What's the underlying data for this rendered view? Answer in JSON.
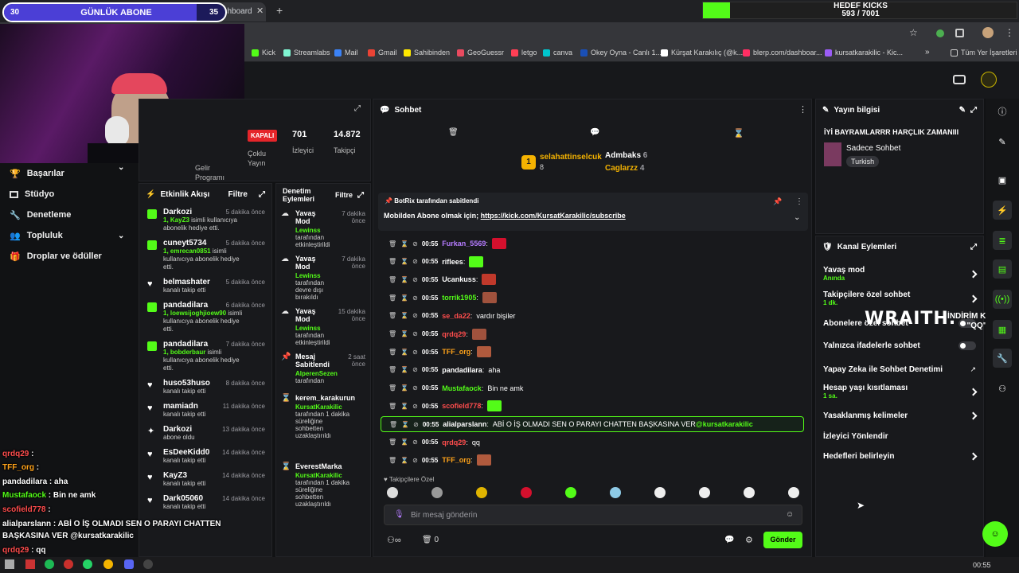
{
  "tabs": [
    {
      "label": "Kick Dashboard"
    }
  ],
  "sub_bar": {
    "left": "30",
    "label": "GÜNLÜK ABONE",
    "right": "35"
  },
  "kick_goal": {
    "title": "HEDEF KICKS",
    "count": "593 / 7001",
    "progress": 0.085
  },
  "bookmarks": [
    {
      "label": "Kick",
      "color": "#53fc18"
    },
    {
      "label": "Streamlabs",
      "color": "#80f5d2"
    },
    {
      "label": "Mail",
      "color": "#3b82f6"
    },
    {
      "label": "Gmail",
      "color": "#ea4335"
    },
    {
      "label": "Sahibinden",
      "color": "#ffe800"
    },
    {
      "label": "GeoGuessr",
      "color": "#e84a5f"
    },
    {
      "label": "letgo",
      "color": "#ff3f55"
    },
    {
      "label": "canva",
      "color": "#00c4cc"
    },
    {
      "label": "Okey Oyna - Canlı 1...",
      "color": "#1a4fb5"
    },
    {
      "label": "Kürşat Karakılıç (@k...",
      "color": "#ffffff"
    },
    {
      "label": "blerp.com/dashboar...",
      "color": "#ff2e63"
    },
    {
      "label": "kursatkarakilic - Kic...",
      "color": "#9b5cf6"
    }
  ],
  "bookmarks_other": "Tüm Yer İşaretleri",
  "sidebar": {
    "items": [
      {
        "label": "Başarılar",
        "icon": "trophy-icon"
      },
      {
        "label": "Stüdyo",
        "icon": "studio-icon"
      },
      {
        "label": "Denetleme",
        "icon": "wrench-icon"
      },
      {
        "label": "Topluluk",
        "icon": "users-icon"
      },
      {
        "label": "Droplar ve ödüller",
        "icon": "gift-icon"
      }
    ]
  },
  "stats": {
    "offline": "KAPALI",
    "multi": "Çoklu Yayın",
    "viewers": "701",
    "viewers_label": "İzleyici",
    "followers": "14.872",
    "followers_label": "Takipçi",
    "revenue": "Gelir Programı"
  },
  "activity": {
    "title": "Etkinlik Akışı",
    "filter": "Filtre",
    "items": [
      {
        "name": "Darkozi",
        "time": "5 dakika önce",
        "hl": "1, KayZ3",
        "desc": " isimli kullanıcıya abonelik hediye etti.",
        "kind": "gift"
      },
      {
        "name": "cuneyt5734",
        "time": "5 dakika önce",
        "hl": "1, emrecan0851",
        "desc": " isimli kullanıcıya abonelik hediye etti.",
        "kind": "gift"
      },
      {
        "name": "belmashater",
        "time": "5 dakika önce",
        "hl": "",
        "desc": "kanalı takip etti",
        "kind": "follow"
      },
      {
        "name": "pandadilara",
        "time": "6 dakika önce",
        "hl": "1, loewsijoghjioew90",
        "desc": " isimli kullanıcıya abonelik hediye etti.",
        "kind": "gift"
      },
      {
        "name": "pandadilara",
        "time": "7 dakika önce",
        "hl": "1, bobderbaur",
        "desc": " isimli kullanıcıya abonelik hediye etti.",
        "kind": "gift"
      },
      {
        "name": "huso53huso",
        "time": "8 dakika önce",
        "hl": "",
        "desc": "kanalı takip etti",
        "kind": "follow"
      },
      {
        "name": "mamiadn",
        "time": "11 dakika önce",
        "hl": "",
        "desc": "kanalı takip etti",
        "kind": "follow"
      },
      {
        "name": "Darkozi",
        "time": "13 dakika önce",
        "hl": "",
        "desc": "abone oldu",
        "kind": "sub"
      },
      {
        "name": "EsDeeKidd0",
        "time": "14 dakika önce",
        "hl": "",
        "desc": "kanalı takip etti",
        "kind": "follow"
      },
      {
        "name": "KayZ3",
        "time": "14 dakika önce",
        "hl": "",
        "desc": "kanalı takip etti",
        "kind": "follow"
      },
      {
        "name": "Dark05060",
        "time": "14 dakika önce",
        "hl": "",
        "desc": "kanalı takip etti",
        "kind": "follow"
      }
    ]
  },
  "modlog": {
    "title": "Denetim Eylemleri",
    "filter": "Filtre",
    "items": [
      {
        "name": "Yavaş Mod",
        "time": "7 dakika önce",
        "who": "Lewinss",
        "desc": " tarafından etkinleştirildi"
      },
      {
        "name": "Yavaş Mod",
        "time": "7 dakika önce",
        "who": "Lewinss",
        "desc": " tarafından devre dışı bırakıldı"
      },
      {
        "name": "Yavaş Mod",
        "time": "15 dakika önce",
        "who": "Lewinss",
        "desc": " tarafından etkinleştirildi"
      },
      {
        "name": "Mesaj Sabitlendi",
        "time": "2 saat önce",
        "who": "AlperenSezen",
        "desc": " tarafından"
      },
      {
        "name": "kerem_karakurun",
        "time": "",
        "who": "KursatKarakilic",
        "desc": " tarafından 1 dakika süreliğine sohbetten uzaklaştırıldı"
      },
      {
        "name": "EverestMarka",
        "time": "",
        "who": "KursatKarakilic",
        "desc": " tarafından 1 dakika süreliğine sohbetten uzaklaştırıldı"
      }
    ]
  },
  "chat": {
    "title": "Sohbet",
    "top_users": [
      {
        "name": "selahattinselcuk",
        "count": "8"
      },
      {
        "name": "Admbaks",
        "count": "6"
      },
      {
        "name": "Caglarzz",
        "count": "4"
      }
    ],
    "pinned_by": "BotRix tarafından sabitlendi",
    "pinned_text": "Mobilden Abone olmak için; ",
    "pinned_link": "https://kick.com/KursatKarakilic/subscribe",
    "messages": [
      {
        "time": "00:55",
        "user": "Furkan_5569",
        "color": "#b57cff",
        "text": "",
        "emote": true
      },
      {
        "time": "00:55",
        "user": "riflees",
        "color": "#ffffff",
        "text": "",
        "emote": true
      },
      {
        "time": "00:55",
        "user": "Ucankuss",
        "color": "#ffffff",
        "text": "",
        "emote": true
      },
      {
        "time": "00:55",
        "user": "torrik1905",
        "color": "#53fc18",
        "text": "",
        "emote": true
      },
      {
        "time": "00:55",
        "user": "se_da22",
        "color": "#ff4d4d",
        "text": "vardır bişiler",
        "emote": false
      },
      {
        "time": "00:55",
        "user": "qrdq29",
        "color": "#ff4d4d",
        "text": "",
        "emote": true
      },
      {
        "time": "00:55",
        "user": "TFF_org",
        "color": "#ffa31a",
        "text": "",
        "emote": true
      },
      {
        "time": "00:55",
        "user": "pandadilara",
        "color": "#ffffff",
        "text": "aha",
        "emote": false
      },
      {
        "time": "00:55",
        "user": "Mustafaock",
        "color": "#53fc18",
        "text": "Bin ne amk",
        "emote": false
      },
      {
        "time": "00:55",
        "user": "scofield778",
        "color": "#ff4d4d",
        "text": "",
        "emote": true
      },
      {
        "time": "00:55",
        "user": "alialparslann",
        "color": "#ffffff",
        "text": "ABİ O İŞ OLMADI SEN O PARAYI CHATTEN BAŞKASINA VER ",
        "mention": "@kursatkarakilic",
        "emote": false
      },
      {
        "time": "00:55",
        "user": "qrdq29",
        "color": "#ff4d4d",
        "text": "qq",
        "emote": false
      },
      {
        "time": "00:55",
        "user": "TFF_org",
        "color": "#ffa31a",
        "text": "",
        "emote": true
      }
    ],
    "emote_tab": "Takipçilere Özel",
    "input_placeholder": "Bir mesaj gönderin",
    "send": "Gönder",
    "kicks": "0"
  },
  "stream_info": {
    "title": "Yayın bilgisi",
    "stream_title": "İYİ BAYRAMLARRR HARÇLIK ZAMANIII",
    "category": "Sadece Sohbet",
    "language": "Turkish"
  },
  "channel_actions": {
    "title": "Kanal Eylemleri",
    "items": [
      {
        "label": "Yavaş mod",
        "sub": "Anında",
        "ctrl": "chev"
      },
      {
        "label": "Takipçilere özel sohbet",
        "sub": "1 dk.",
        "ctrl": "chev"
      },
      {
        "label": "Abonelere özel sohbet",
        "sub": "",
        "ctrl": "toggle"
      },
      {
        "label": "Yalnızca ifadelerle sohbet",
        "sub": "",
        "ctrl": "toggle"
      },
      {
        "label": "Yapay Zeka ile Sohbet Denetimi",
        "sub": "",
        "ctrl": "ext"
      },
      {
        "label": "Hesap yaşı kısıtlaması",
        "sub": "1 sa.",
        "ctrl": "chev"
      },
      {
        "label": "Yasaklanmış kelimeler",
        "sub": "",
        "ctrl": "chev"
      },
      {
        "label": "İzleyici Yönlendir",
        "sub": "",
        "ctrl": "none"
      },
      {
        "label": "Hedefleri belirleyin",
        "sub": "",
        "ctrl": "chev"
      }
    ]
  },
  "promo": {
    "brand": "WRAITH.",
    "text": "İNDİRİM KODU: \"QQ\""
  },
  "overlay_chat": [
    {
      "user": "qrdq29",
      "color": "#ff4d4d",
      "text": " : "
    },
    {
      "user": "TFF_org",
      "color": "#ffa31a",
      "text": " : "
    },
    {
      "user": "pandadilara",
      "color": "#ffffff",
      "text": " : aha"
    },
    {
      "user": "Mustafaock",
      "color": "#53fc18",
      "text": " : Bin ne amk"
    },
    {
      "user": "scofield778",
      "color": "#ff4d4d",
      "text": " : "
    },
    {
      "user": "alialparslann",
      "color": "#ffffff",
      "text": " : ABİ O İŞ OLMADI SEN O PARAYI CHATTEN"
    },
    {
      "user": "",
      "color": "#ffffff",
      "text": "BAŞKASINA VER @kursatkarakilic"
    },
    {
      "user": "qrdq29",
      "color": "#ff4d4d",
      "text": " : qq"
    }
  ],
  "clock": "00:55",
  "accent": "#53fc18"
}
